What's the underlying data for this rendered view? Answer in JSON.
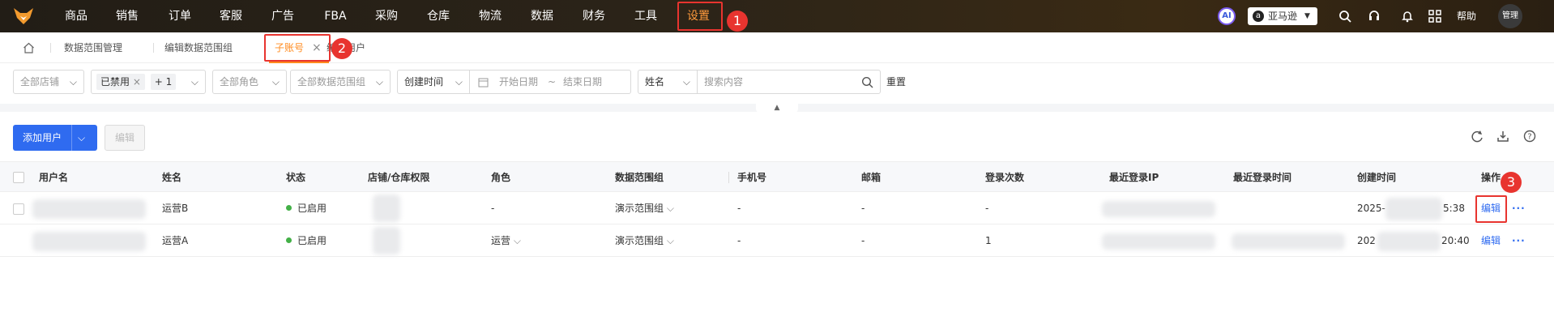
{
  "nav": {
    "items": [
      {
        "label": "商品"
      },
      {
        "label": "销售"
      },
      {
        "label": "订单"
      },
      {
        "label": "客服"
      },
      {
        "label": "广告"
      },
      {
        "label": "FBA"
      },
      {
        "label": "采购"
      },
      {
        "label": "仓库"
      },
      {
        "label": "物流"
      },
      {
        "label": "数据"
      },
      {
        "label": "财务"
      },
      {
        "label": "工具"
      },
      {
        "label": "设置"
      }
    ],
    "ai_label": "AI",
    "platform": "亚马逊",
    "help": "帮助",
    "user": "管理"
  },
  "annotations": {
    "one": "1",
    "two": "2",
    "three": "3"
  },
  "tabs": {
    "items": [
      {
        "label": "数据范围管理"
      },
      {
        "label": "编辑数据范围组"
      },
      {
        "label": "子账号"
      },
      {
        "label": "编辑用户"
      }
    ],
    "close": "×"
  },
  "filters": {
    "shop": "全部店铺",
    "status_tag": "已禁用",
    "status_more": "+ 1",
    "role": "全部角色",
    "scope": "全部数据范围组",
    "time_type": "创建时间",
    "start_placeholder": "开始日期",
    "range_sep": "~",
    "end_placeholder": "结束日期",
    "search_field": "姓名",
    "search_placeholder": "搜索内容",
    "reset": "重置"
  },
  "toolbar": {
    "add_user": "添加用户",
    "edit": "编辑"
  },
  "table": {
    "headers": [
      "用户名",
      "姓名",
      "状态",
      "店铺/仓库权限",
      "角色",
      "数据范围组",
      "手机号",
      "邮箱",
      "登录次数",
      "最近登录IP",
      "最近登录时间",
      "创建时间",
      "操作"
    ],
    "rows": [
      {
        "name": "运营B",
        "status": "已启用",
        "role": "-",
        "scope": "演示范围组",
        "phone": "-",
        "email": "-",
        "logins": "-",
        "created_prefix": "2025-",
        "created_suffix": "5:38",
        "edit": "编辑",
        "more": "···"
      },
      {
        "name": "运营A",
        "status": "已启用",
        "role": "运营",
        "scope": "演示范围组",
        "phone": "-",
        "email": "-",
        "logins": "1",
        "created_prefix": "202",
        "created_suffix": "20:40",
        "edit": "编辑",
        "more": "···"
      }
    ]
  },
  "colors": {
    "accent": "#2f6bf0",
    "active_nav": "#ff9a3c",
    "highlight": "#e8342f",
    "status_green": "#43b047"
  }
}
